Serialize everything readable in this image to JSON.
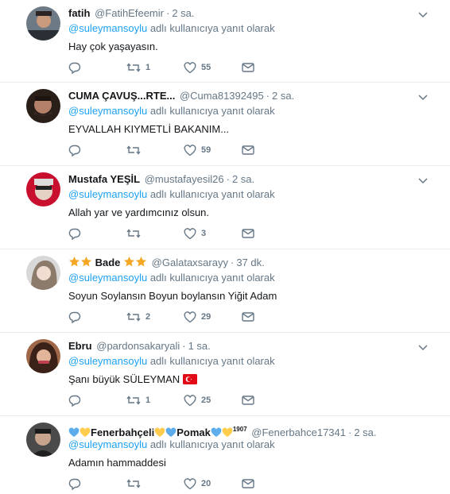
{
  "reply_prefix": "adlı kullanıcıya yanıt olarak",
  "mention": "@suleymansoylu",
  "tweets": [
    {
      "name": "fatih",
      "handle": "@FatihEfeemir",
      "time": "2 sa.",
      "text": "Hay çok yaşayasın.",
      "replies": "",
      "retweets": "1",
      "likes": "55"
    },
    {
      "name": "CUMA ÇAVUŞ...RTE...",
      "handle": "@Cuma81392495",
      "time": "2 sa.",
      "text": "EYVALLAH KIYMETLİ BAKANIM...",
      "replies": "",
      "retweets": "",
      "likes": "59"
    },
    {
      "name": "Mustafa YEŞİL",
      "handle": "@mustafayesil26",
      "time": "2 sa.",
      "text": "Allah yar ve yardımcınız olsun.",
      "replies": "",
      "retweets": "",
      "likes": "3"
    },
    {
      "name": "Bade",
      "handle": "@Galataxsarayy",
      "time": "37 dk.",
      "text": "Soyun Soylansın Boyun boylansın Yiğit Adam",
      "replies": "",
      "retweets": "2",
      "likes": "29"
    },
    {
      "name": "Ebru",
      "handle": "@pardonsakaryali",
      "time": "1 sa.",
      "text": "Şanı büyük SÜLEYMAN",
      "replies": "",
      "retweets": "1",
      "likes": "25"
    },
    {
      "name_part1": "Fenerbahçeli",
      "name_part2": "Pomak",
      "name_sup": "1907",
      "handle": "@Fenerbahce17341",
      "time": "2 sa.",
      "text": "Adamın hammaddesi",
      "replies": "",
      "retweets": "",
      "likes": "20"
    }
  ],
  "colors": {
    "accent": "#1da1f2",
    "muted": "#657786",
    "star": "#f5a623",
    "heart_blue": "#5dadec",
    "heart_yellow": "#ffcc4d",
    "flag_red": "#e30a17"
  }
}
